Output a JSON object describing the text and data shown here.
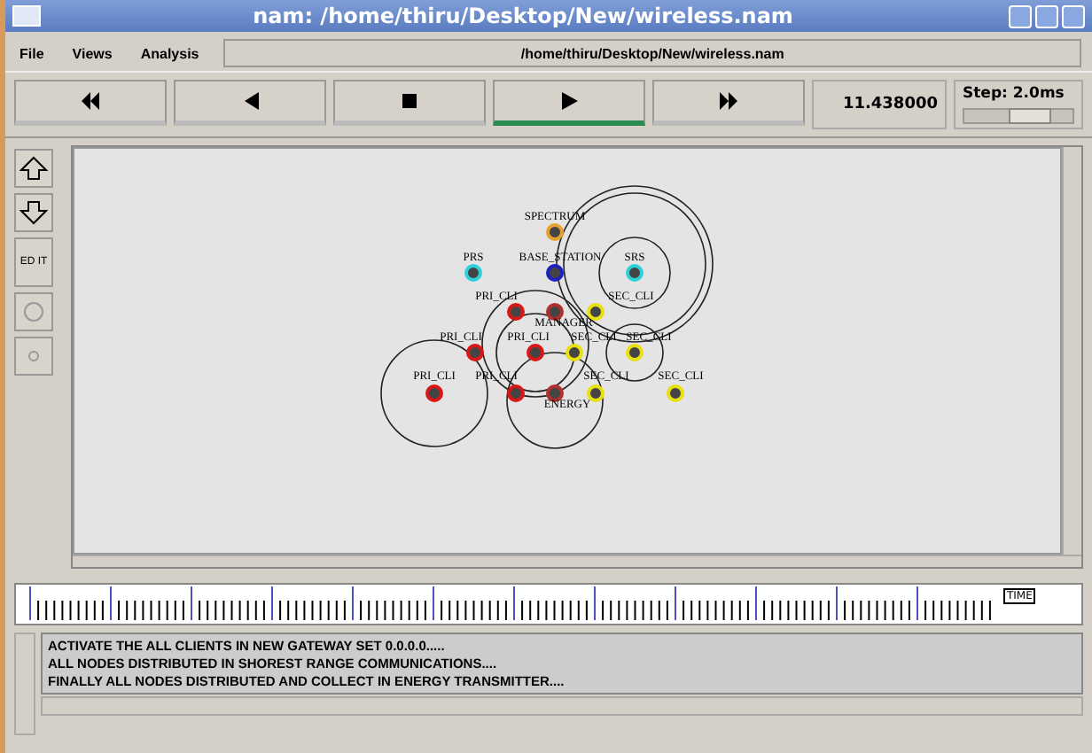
{
  "window": {
    "title": "nam: /home/thiru/Desktop/New/wireless.nam"
  },
  "menu": [
    "File",
    "Views",
    "Analysis"
  ],
  "path_field": {
    "value": "/home/thiru/Desktop/New/wireless.nam"
  },
  "playback": [
    {
      "kind": "rewind",
      "selected": false
    },
    {
      "kind": "back",
      "selected": false
    },
    {
      "kind": "stop",
      "selected": false
    },
    {
      "kind": "play",
      "selected": true
    },
    {
      "kind": "forward",
      "selected": false
    }
  ],
  "time": "11.438000",
  "step": {
    "label": "Step: 2.0ms",
    "level": 0.6
  },
  "tools": [
    {
      "kind": "zoom-in"
    },
    {
      "kind": "zoom-out"
    },
    {
      "kind": "edit",
      "label": "ED IT"
    },
    {
      "kind": "circle"
    },
    {
      "kind": "dot"
    }
  ],
  "nodes": [
    {
      "label": "SPECTRUM",
      "color": "#e8a030"
    },
    {
      "label": "PRS",
      "color": "#30d0d8"
    },
    {
      "label": "BASE_STATION",
      "color": "#2020c0"
    },
    {
      "label": "SRS",
      "color": "#30d0d8"
    },
    {
      "label": "PRI_CLI",
      "color": "#d81818"
    },
    {
      "label": "MANAGER",
      "color": "#b03030"
    },
    {
      "label": "SEC_CLI",
      "color": "#e8e010"
    },
    {
      "label": "PRI_CLI",
      "color": "#d81818"
    },
    {
      "label": "PRI_CLI",
      "color": "#d81818"
    },
    {
      "label": "SEC_CLI",
      "color": "#e8e010"
    },
    {
      "label": "SEC_CLI",
      "color": "#e8e010"
    },
    {
      "label": "PRI_CLI",
      "color": "#d81818"
    },
    {
      "label": "PRI_CLI",
      "color": "#d81818"
    },
    {
      "label": "ENERGY",
      "color": "#b03030"
    },
    {
      "label": "SEC_CLI",
      "color": "#e8e010"
    },
    {
      "label": "SEC_CLI",
      "color": "#e8e010"
    }
  ],
  "timeline": {
    "marker": "TIME"
  },
  "log": [
    "ACTIVATE THE ALL CLIENTS IN NEW GATEWAY SET 0.0.0.0.....",
    "ALL NODES DISTRIBUTED IN SHOREST RANGE COMMUNICATIONS....",
    "FINALLY ALL NODES DISTRIBUTED AND COLLECT IN ENERGY TRANSMITTER...."
  ]
}
